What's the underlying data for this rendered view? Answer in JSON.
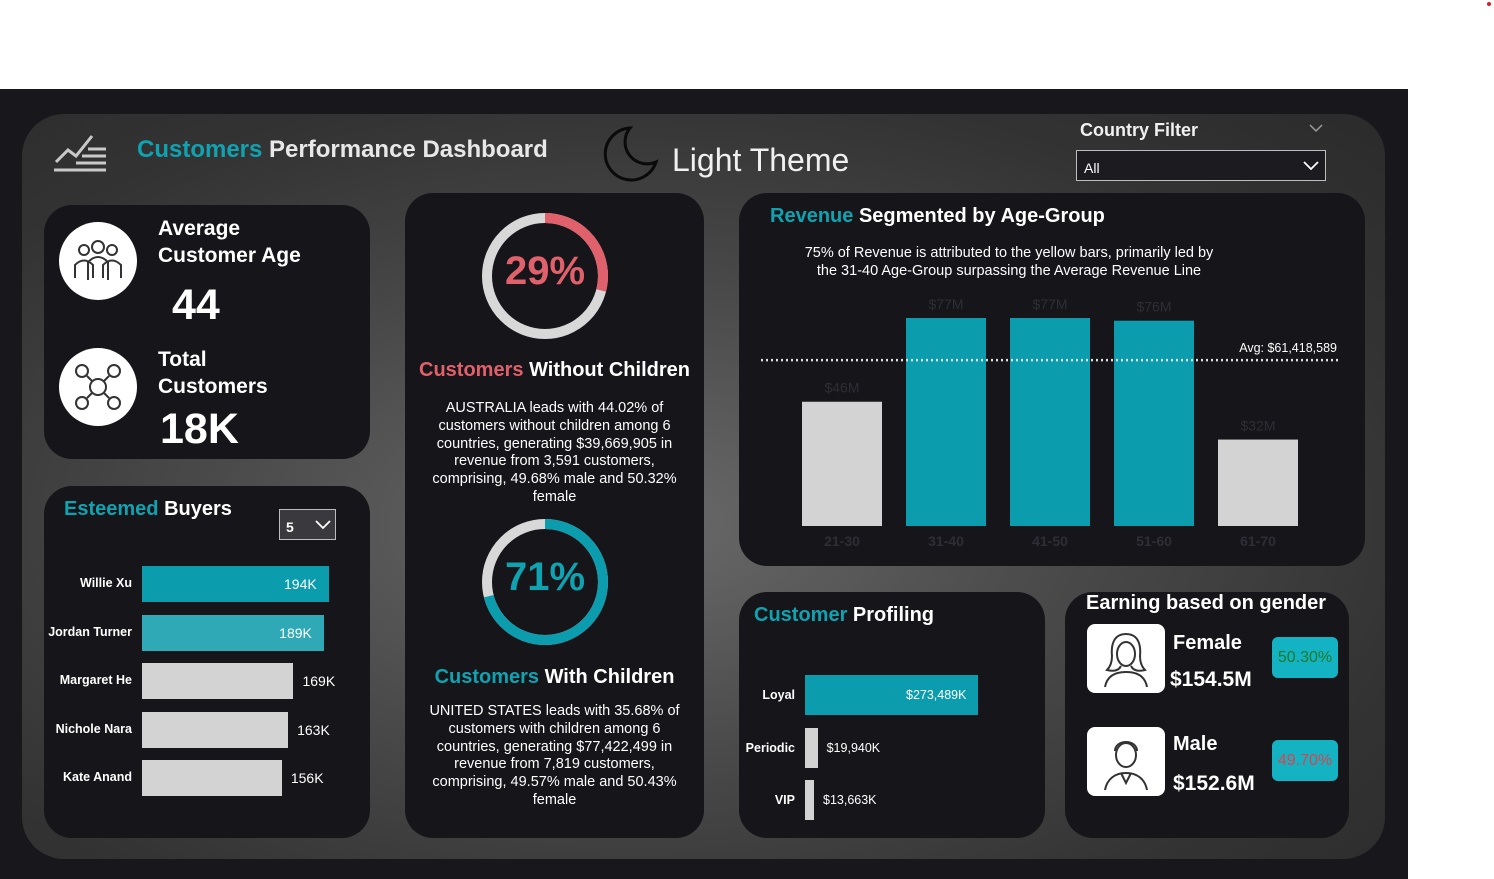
{
  "header": {
    "title_accent": "Customers",
    "title_rest": "Performance Dashboard",
    "theme_label": "Light Theme",
    "country_filter_label": "Country Filter",
    "country_filter_value": "All"
  },
  "kpi": {
    "avg_age_label_1": "Average",
    "avg_age_label_2": "Customer Age",
    "avg_age_value": "44",
    "total_label_1": "Total",
    "total_label_2": "Customers",
    "total_value": "18K"
  },
  "esteemed": {
    "title_accent": "Esteemed",
    "title_rest": "Buyers",
    "top_n": "5",
    "buyers": [
      {
        "name": "Willie Xu",
        "value": "194K",
        "amount": 194
      },
      {
        "name": "Jordan Turner",
        "value": "189K",
        "amount": 189
      },
      {
        "name": "Margaret He",
        "value": "169K",
        "amount": 169
      },
      {
        "name": "Nichole Nara",
        "value": "163K",
        "amount": 163
      },
      {
        "name": "Kate Anand",
        "value": "156K",
        "amount": 156
      }
    ]
  },
  "children": {
    "without_pct": "29%",
    "without_fraction": 0.29,
    "without_title_accent": "Customers",
    "without_title_rest": "Without Children",
    "without_text": "AUSTRALIA leads with 44.02% of customers without children among 6 countries, generating $39,669,905 in revenue from 3,591 customers, comprising, 49.68% male and 50.32% female",
    "with_pct": "71%",
    "with_fraction": 0.71,
    "with_title_accent": "Customers",
    "with_title_rest": "With Children",
    "with_text": "UNITED STATES leads with 35.68% of customers with children among 6 countries, generating $77,422,499 in revenue from 7,819 customers, comprising, 49.57% male and 50.43% female"
  },
  "revenue": {
    "title_accent": "Revenue",
    "title_rest": "Segmented by Age-Group",
    "subtitle_1": "75% of Revenue is attributed to the yellow bars, primarily led by",
    "subtitle_2": "the 31-40 Age-Group surpassing the Average Revenue Line",
    "avg_label": "Avg: $61,418,589"
  },
  "chart_data": {
    "type": "bar",
    "categories": [
      "21-30",
      "31-40",
      "41-50",
      "51-60",
      "61-70"
    ],
    "values": [
      46,
      77,
      77,
      76,
      32
    ],
    "value_labels": [
      "$46M",
      "$77M",
      "$77M",
      "$76M",
      "$32M"
    ],
    "highlight": [
      false,
      true,
      true,
      true,
      false
    ],
    "average": 61.418589,
    "ylim": [
      0,
      80
    ],
    "colors": {
      "highlight": "#0b9cad",
      "normal": "#d3d3d3",
      "avg_line": "#e0e0e0"
    }
  },
  "profiling": {
    "title_accent": "Customer",
    "title_rest": "Profiling",
    "rows": [
      {
        "label": "Loyal",
        "value": "$273,489K",
        "amount": 273489
      },
      {
        "label": "Periodic",
        "value": "$19,940K",
        "amount": 19940
      },
      {
        "label": "VIP",
        "value": "$13,663K",
        "amount": 13663
      }
    ]
  },
  "gender": {
    "title": "Earning based on gender",
    "female_label": "Female",
    "female_value": "$154.5M",
    "female_pct": "50.30%",
    "male_label": "Male",
    "male_value": "$152.6M",
    "male_pct": "49.70%"
  },
  "colors": {
    "accent": "#0fa3b1",
    "bar_teal": "#0b9cad",
    "bar_grey": "#d3d3d3",
    "donut_red": "#e0606b",
    "card_bg": "#15151a"
  }
}
